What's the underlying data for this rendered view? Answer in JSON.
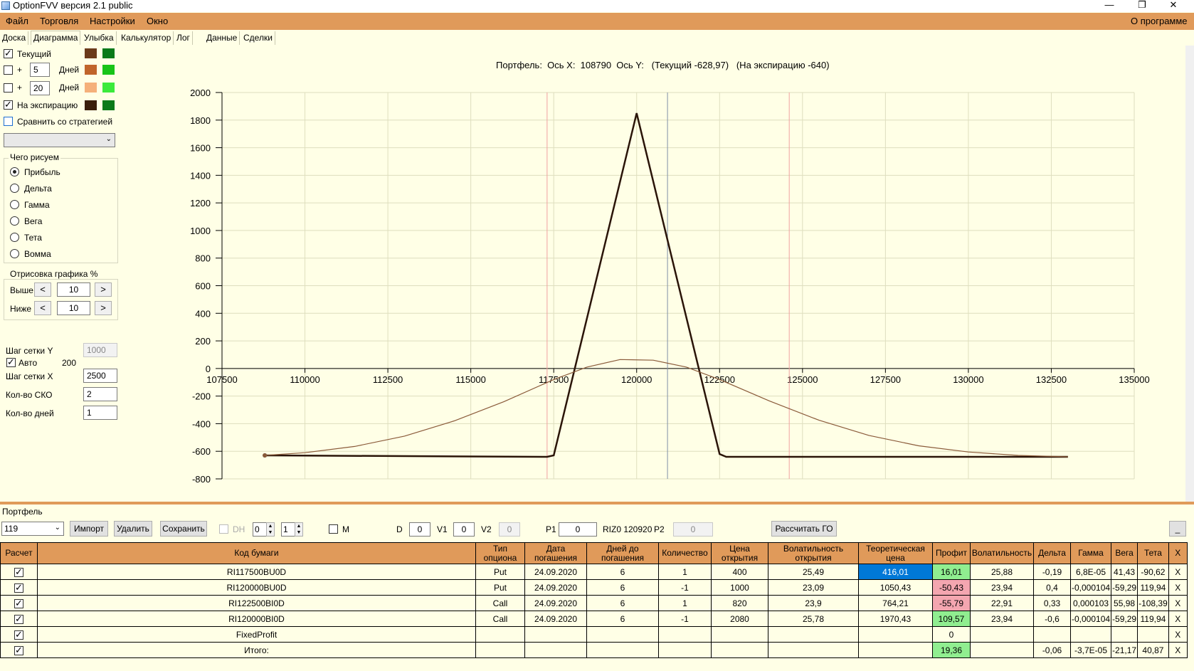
{
  "window": {
    "title": "OptionFVV версия 2.1 public",
    "minimize": "—",
    "restore": "❐",
    "close": "✕"
  },
  "menu": {
    "items": [
      "Файл",
      "Торговля",
      "Настройки",
      "Окно"
    ],
    "about": "О программе"
  },
  "tabs": [
    "Доска",
    "Диаграмма",
    "Улыбка",
    "Калькулятор",
    "Лог",
    "Данные",
    "Сделки"
  ],
  "left_panel": {
    "current_label": "Текущий",
    "plus": "+",
    "days_label": "Дней",
    "days1": "5",
    "days2": "20",
    "expiry_label": "На экспирацию",
    "compare_label": "Сравнить со стратегией",
    "draw_group_label": "Чего рисуем",
    "draw_options": [
      "Прибыль",
      "Дельта",
      "Гамма",
      "Вега",
      "Тета",
      "Вомма"
    ],
    "draw_selected": 0,
    "render_group_label": "Отрисовка графика %",
    "above_label": "Выше",
    "below_label": "Ниже",
    "above_value": "10",
    "below_value": "10",
    "arrow_left": "<",
    "arrow_right": ">",
    "grid_step_y_label": "Шаг сетки Y",
    "grid_step_y_value": "1000",
    "auto_label": "Авто",
    "auto_value": "200",
    "grid_step_x_label": "Шаг сетки X",
    "grid_step_x_value": "2500",
    "sko_label": "Кол-во СКО",
    "sko_value": "2",
    "days_count_label": "Кол-во дней",
    "days_count_value": "1",
    "colors": {
      "current_a": "#6b3a1a",
      "current_b": "#0a7a1a",
      "d5_a": "#c0652a",
      "d5_b": "#18c418",
      "d20_a": "#f5b07a",
      "d20_b": "#3bea3b",
      "exp_a": "#3a1e0a",
      "exp_b": "#0a7a1a"
    }
  },
  "chart_title": "Портфель:  Ось X:  108790  Ось Y:   (Текущий -628,97)   (На экспирацию -640)",
  "chart_data": {
    "type": "line",
    "xlim": [
      107500,
      135000
    ],
    "ylim": [
      -800,
      2000
    ],
    "x_ticks": [
      107500,
      110000,
      112500,
      115000,
      117500,
      120000,
      122500,
      125000,
      127500,
      130000,
      132500,
      135000
    ],
    "y_ticks": [
      2000,
      1800,
      1600,
      1400,
      1200,
      1000,
      800,
      600,
      400,
      200,
      0,
      -200,
      -400,
      -600,
      -800
    ],
    "grid": true,
    "vlines": [
      {
        "x": 117300,
        "color": "#f0a0a0"
      },
      {
        "x": 120930,
        "color": "#8090a8"
      },
      {
        "x": 124600,
        "color": "#f0a0a0"
      }
    ],
    "series": [
      {
        "color": "#2a1408",
        "x": [
          108790,
          117300,
          117500,
          120000,
          122500,
          122700,
          133000
        ],
        "y": [
          -630,
          -640,
          -630,
          1850,
          -620,
          -640,
          -640
        ]
      },
      {
        "color": "#8a5a3a",
        "x": [
          108790,
          110000,
          111500,
          113000,
          114500,
          116000,
          117500,
          118500,
          119500,
          120500,
          121500,
          122500,
          124000,
          125500,
          127000,
          128500,
          130000,
          131500,
          133000
        ],
        "y": [
          -630,
          -610,
          -565,
          -490,
          -380,
          -240,
          -80,
          10,
          65,
          60,
          10,
          -80,
          -235,
          -375,
          -485,
          -560,
          -605,
          -630,
          -640
        ]
      }
    ]
  },
  "portfolio": {
    "label": "Портфель",
    "selected": "119",
    "import": "Импорт",
    "delete": "Удалить",
    "save": "Сохранить",
    "dh_label": "DH",
    "spin1": "0",
    "spin2": "1",
    "m_label": "M",
    "d_label": "D",
    "d_value": "0",
    "v1_label": "V1",
    "v1_value": "0",
    "v2_label": "V2",
    "v2_value": "0",
    "p1_label": "P1",
    "p1_value": "0",
    "riz_label": "RIZ0 120920",
    "p2_label": "P2",
    "p2_value": "0",
    "calc_go": "Рассчитать ГО",
    "minimize": "_"
  },
  "table": {
    "headers": [
      "Расчет",
      "Код бумаги",
      "Тип\nопциона",
      "Дата\nпогашения",
      "Дней до\nпогашения",
      "Количество",
      "Цена\nоткрытия",
      "Волатильность\nоткрытия",
      "Теоретическая\nцена",
      "Профит",
      "Волатильность",
      "Дельта",
      "Гамма",
      "Вега",
      "Тета",
      "X"
    ],
    "rows": [
      [
        "",
        "RI117500BU0D",
        "Put",
        "24.09.2020",
        "6",
        "1",
        "400",
        "25,49",
        "416,01",
        "16,01",
        "25,88",
        "-0,19",
        "6,8E-05",
        "41,43",
        "-90,62",
        "X"
      ],
      [
        "",
        "RI120000BU0D",
        "Put",
        "24.09.2020",
        "6",
        "-1",
        "1000",
        "23,09",
        "1050,43",
        "-50,43",
        "23,94",
        "0,4",
        "-0,000104",
        "-59,29",
        "119,94",
        "X"
      ],
      [
        "",
        "RI122500BI0D",
        "Call",
        "24.09.2020",
        "6",
        "1",
        "820",
        "23,9",
        "764,21",
        "-55,79",
        "22,91",
        "0,33",
        "0,000103",
        "55,98",
        "-108,39",
        "X"
      ],
      [
        "",
        "RI120000BI0D",
        "Call",
        "24.09.2020",
        "6",
        "-1",
        "2080",
        "25,78",
        "1970,43",
        "109,57",
        "23,94",
        "-0,6",
        "-0,000104",
        "-59,29",
        "119,94",
        "X"
      ],
      [
        "",
        "FixedProfit",
        "",
        "",
        "",
        "",
        "",
        "",
        "",
        "0",
        "",
        "",
        "",
        "",
        "",
        "X"
      ],
      [
        "",
        "Итого:",
        "",
        "",
        "",
        "",
        "",
        "",
        "",
        "19,36",
        "",
        "-0,06",
        "-3,7E-05",
        "-21,17",
        "40,87",
        "X"
      ]
    ],
    "cell_colors": {
      "0-8": "blue",
      "0-9": "green",
      "1-9": "pink",
      "2-9": "pink",
      "3-9": "green",
      "5-9": "green"
    }
  }
}
